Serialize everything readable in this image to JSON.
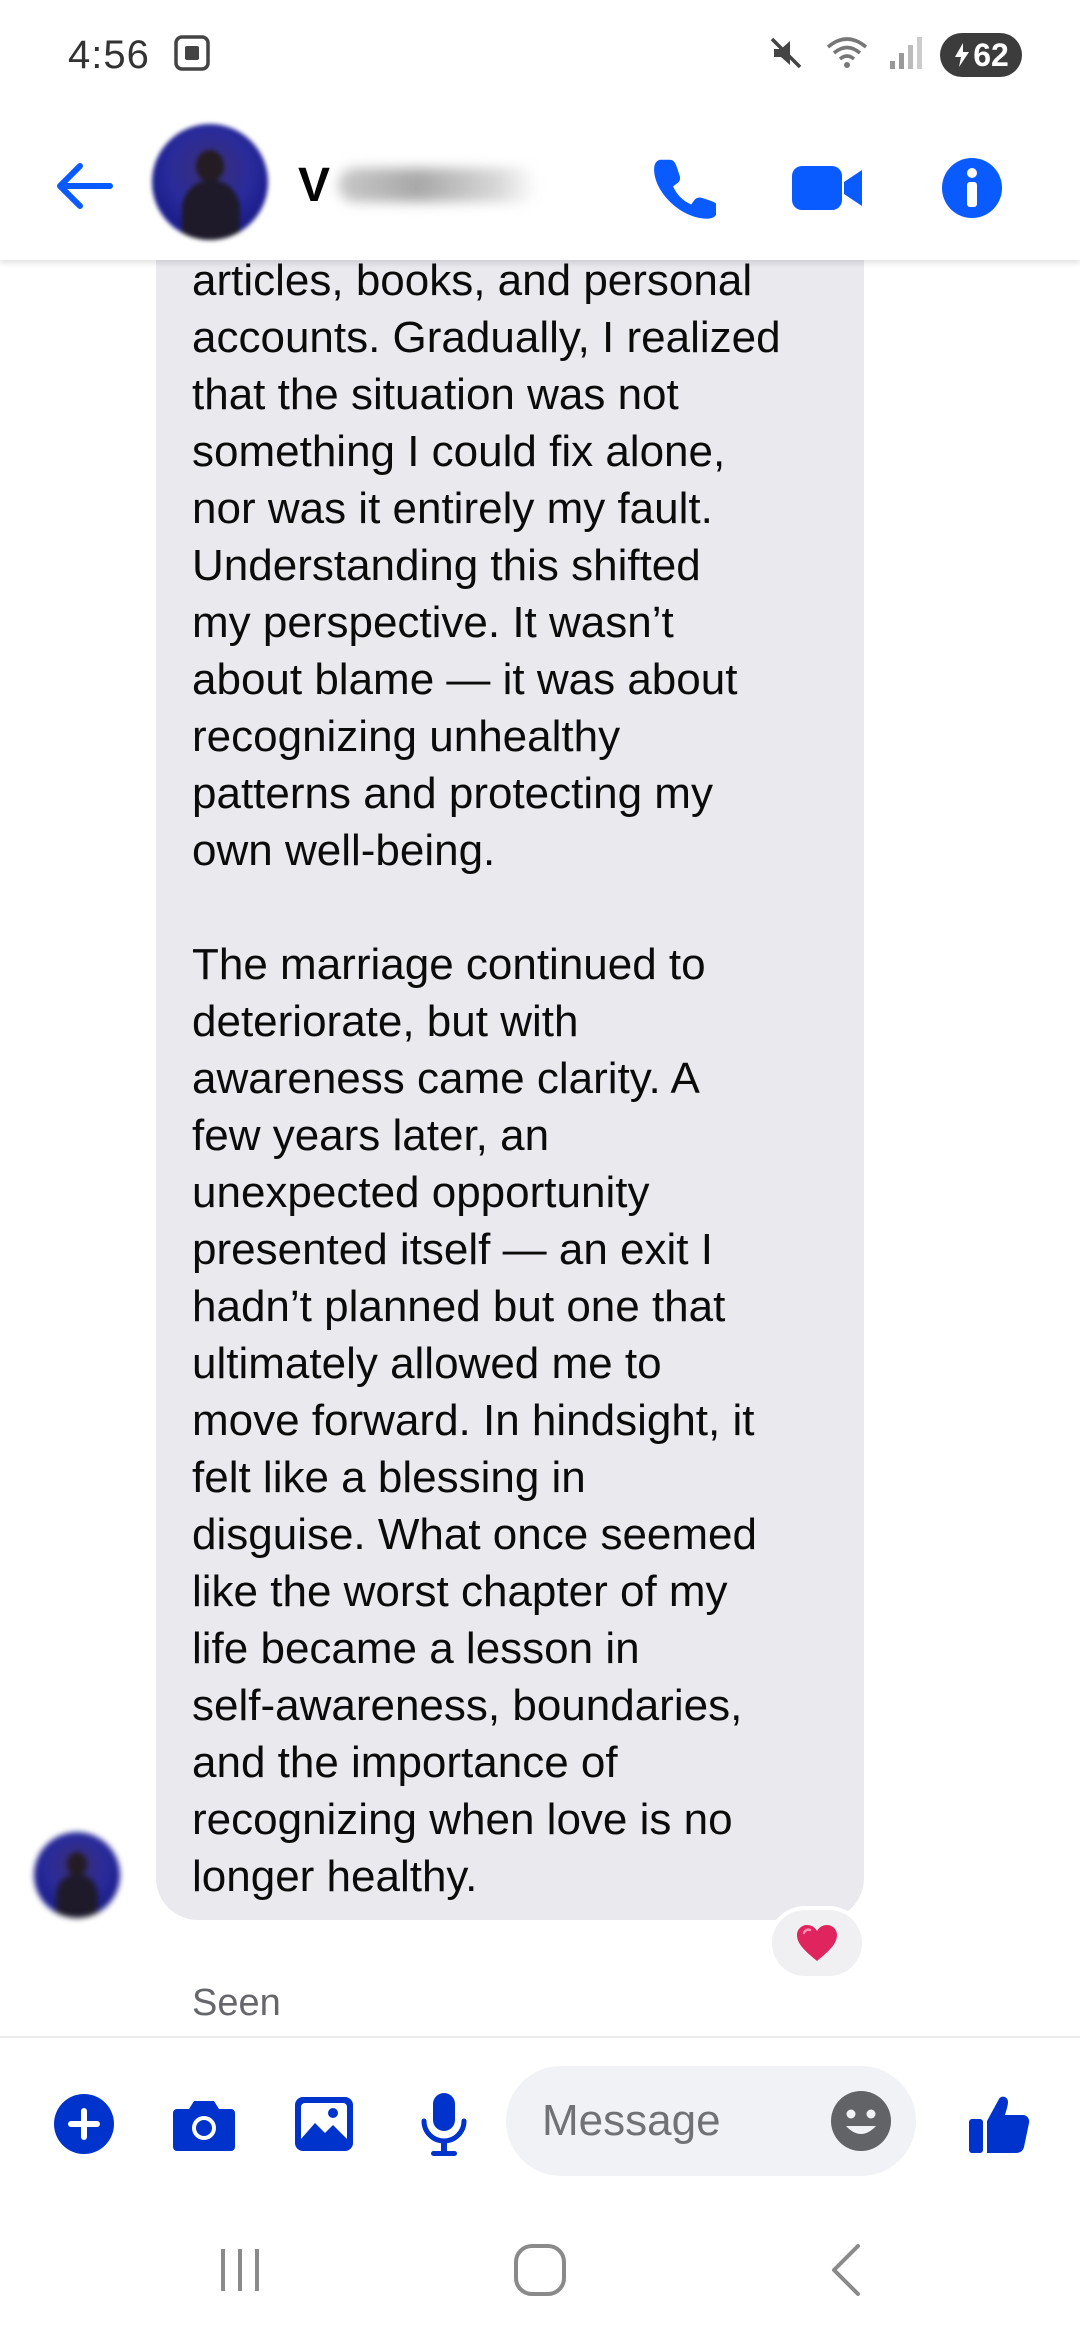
{
  "status_bar": {
    "time": "4:56",
    "battery_level": "62",
    "icons": [
      "screenshot-icon",
      "mute-icon",
      "wifi-icon",
      "signal-icon",
      "battery-icon"
    ]
  },
  "header": {
    "contact_initial": "V",
    "actions": [
      "back-arrow-icon",
      "phone-icon",
      "video-camera-icon",
      "info-icon"
    ]
  },
  "message": {
    "text": "articles, books, and personal\naccounts. Gradually, I realized\nthat the situation was not\nsomething I could fix alone,\nnor was it entirely my fault.\nUnderstanding this shifted\nmy perspective. It wasn’t\nabout blame — it was about\nrecognizing unhealthy\npatterns and protecting my\nown well-being.\n\nThe marriage continued to\ndeteriorate, but with\nawareness came clarity. A\nfew years later, an\nunexpected opportunity\npresented itself — an exit I\nhadn’t planned but one that\nultimately allowed me to\nmove forward. In hindsight, it\nfelt like a blessing in\ndisguise. What once seemed\nlike the worst chapter of my\nlife became a lesson in\nself-awareness, boundaries,\nand the importance of\nrecognizing when love is no\nlonger healthy.",
    "reaction": "heart"
  },
  "seen_label": "Seen",
  "composer": {
    "placeholder": "Message",
    "actions": [
      "plus-icon",
      "camera-icon",
      "gallery-icon",
      "microphone-icon",
      "emoji-icon",
      "thumbs-up-icon"
    ]
  },
  "colors": {
    "accent": "#0a5bff",
    "composer_icon": "#0033cc",
    "bubble": "#e9e9ee",
    "reaction_heart": "#e0245e"
  }
}
